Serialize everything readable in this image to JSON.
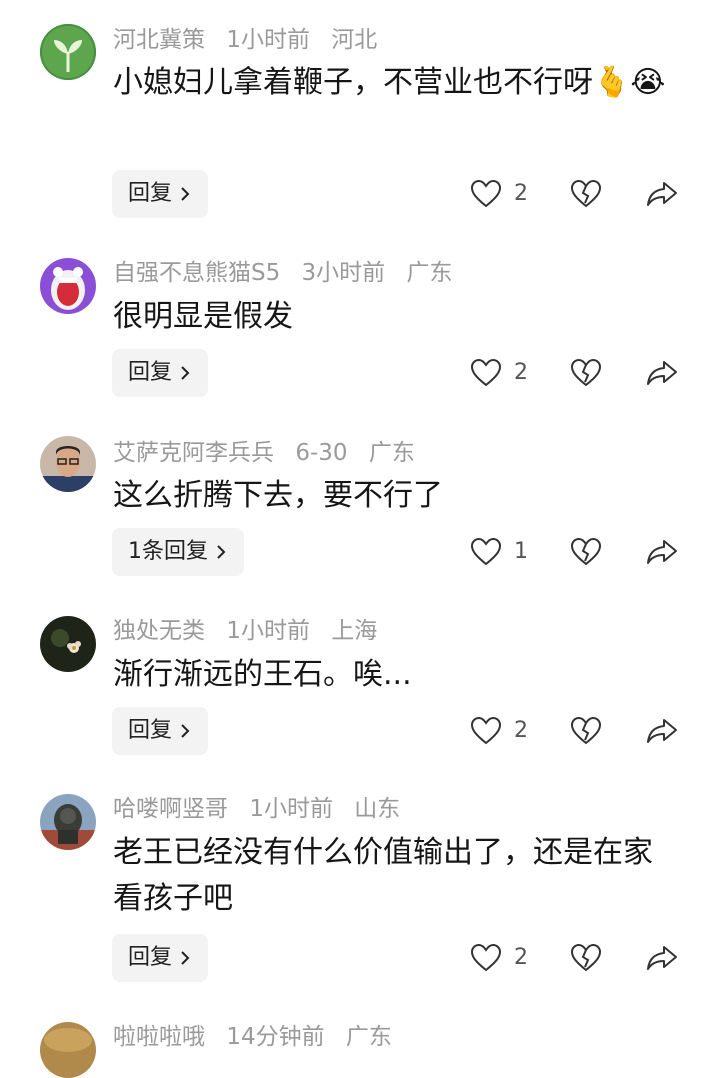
{
  "comments": [
    {
      "user": "河北冀策",
      "time": "1小时前",
      "location": "河北",
      "text": "小媳妇儿拿着鞭子，不营业也不行呀🫰😭",
      "reply_label": "回复",
      "likes": "2",
      "avatar": "sprout-avatar"
    },
    {
      "user": "自强不息熊猫S5",
      "time": "3小时前",
      "location": "广东",
      "text": "很明显是假发",
      "reply_label": "回复",
      "likes": "2",
      "avatar": "cartoon-mouth-avatar"
    },
    {
      "user": "艾萨克阿李兵兵",
      "time": "6-30",
      "location": "广东",
      "text": "这么折腾下去，要不行了",
      "reply_label": "1条回复",
      "likes": "1",
      "avatar": "man-glasses-avatar"
    },
    {
      "user": "独处无类",
      "time": "1小时前",
      "location": "上海",
      "text": "渐行渐远的王石。唉...",
      "reply_label": "回复",
      "likes": "2",
      "avatar": "flower-dark-avatar"
    },
    {
      "user": "哈喽啊竖哥",
      "time": "1小时前",
      "location": "山东",
      "text": "老王已经没有什么价值输出了，还是在家看孩子吧",
      "reply_label": "回复",
      "likes": "2",
      "avatar": "stone-lion-avatar"
    },
    {
      "user": "啦啦啦哦",
      "time": "14分钟前",
      "location": "广东",
      "avatar": "sand-avatar"
    }
  ],
  "colors": {
    "meta": "#9a9a9a",
    "text": "#161616",
    "button_bg": "#f3f3f3",
    "icon": "#333333"
  }
}
